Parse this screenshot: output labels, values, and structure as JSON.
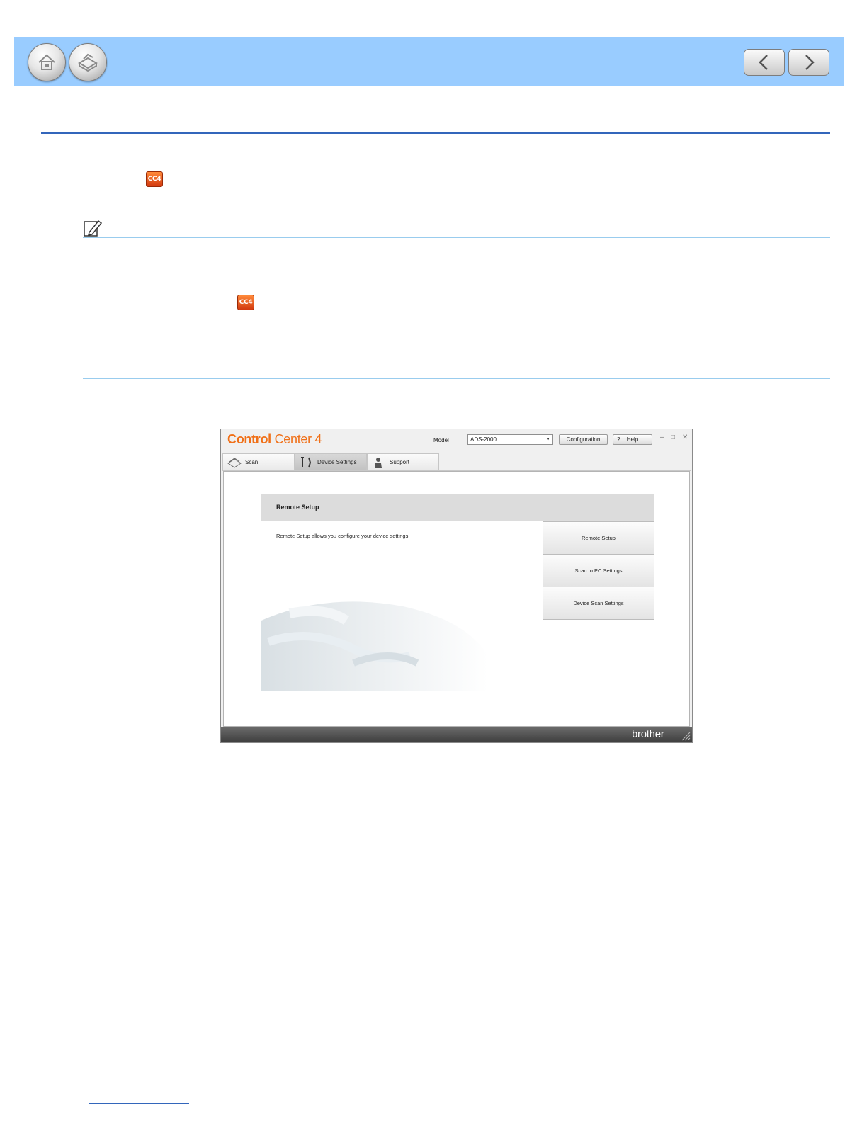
{
  "header": {
    "home_icon": "home-icon",
    "scan_icon": "scanner-icon",
    "prev_icon": "chevron-left-icon",
    "next_icon": "chevron-right-icon",
    "bar_color": "#99ccff"
  },
  "inline_icons": {
    "cc4_text": "CC4"
  },
  "window": {
    "title_bold": "Control",
    "title_regular": "Center 4",
    "model_label": "Model",
    "model_value": "ADS-2000",
    "configuration_label": "Configuration",
    "help_q": "?",
    "help_label": "Help",
    "tabs": [
      {
        "label": "Scan"
      },
      {
        "label": "Device Settings"
      },
      {
        "label": "Support"
      }
    ],
    "section_title": "Remote Setup",
    "section_description": "Remote Setup allows you configure your device settings.",
    "buttons": [
      {
        "label": "Remote Setup"
      },
      {
        "label": "Scan to PC Settings"
      },
      {
        "label": "Device Scan Settings"
      }
    ],
    "brand": "brother"
  },
  "colors": {
    "accent_orange": "#f07018",
    "rule_blue": "#3366bb",
    "note_rule": "#99ccee"
  }
}
